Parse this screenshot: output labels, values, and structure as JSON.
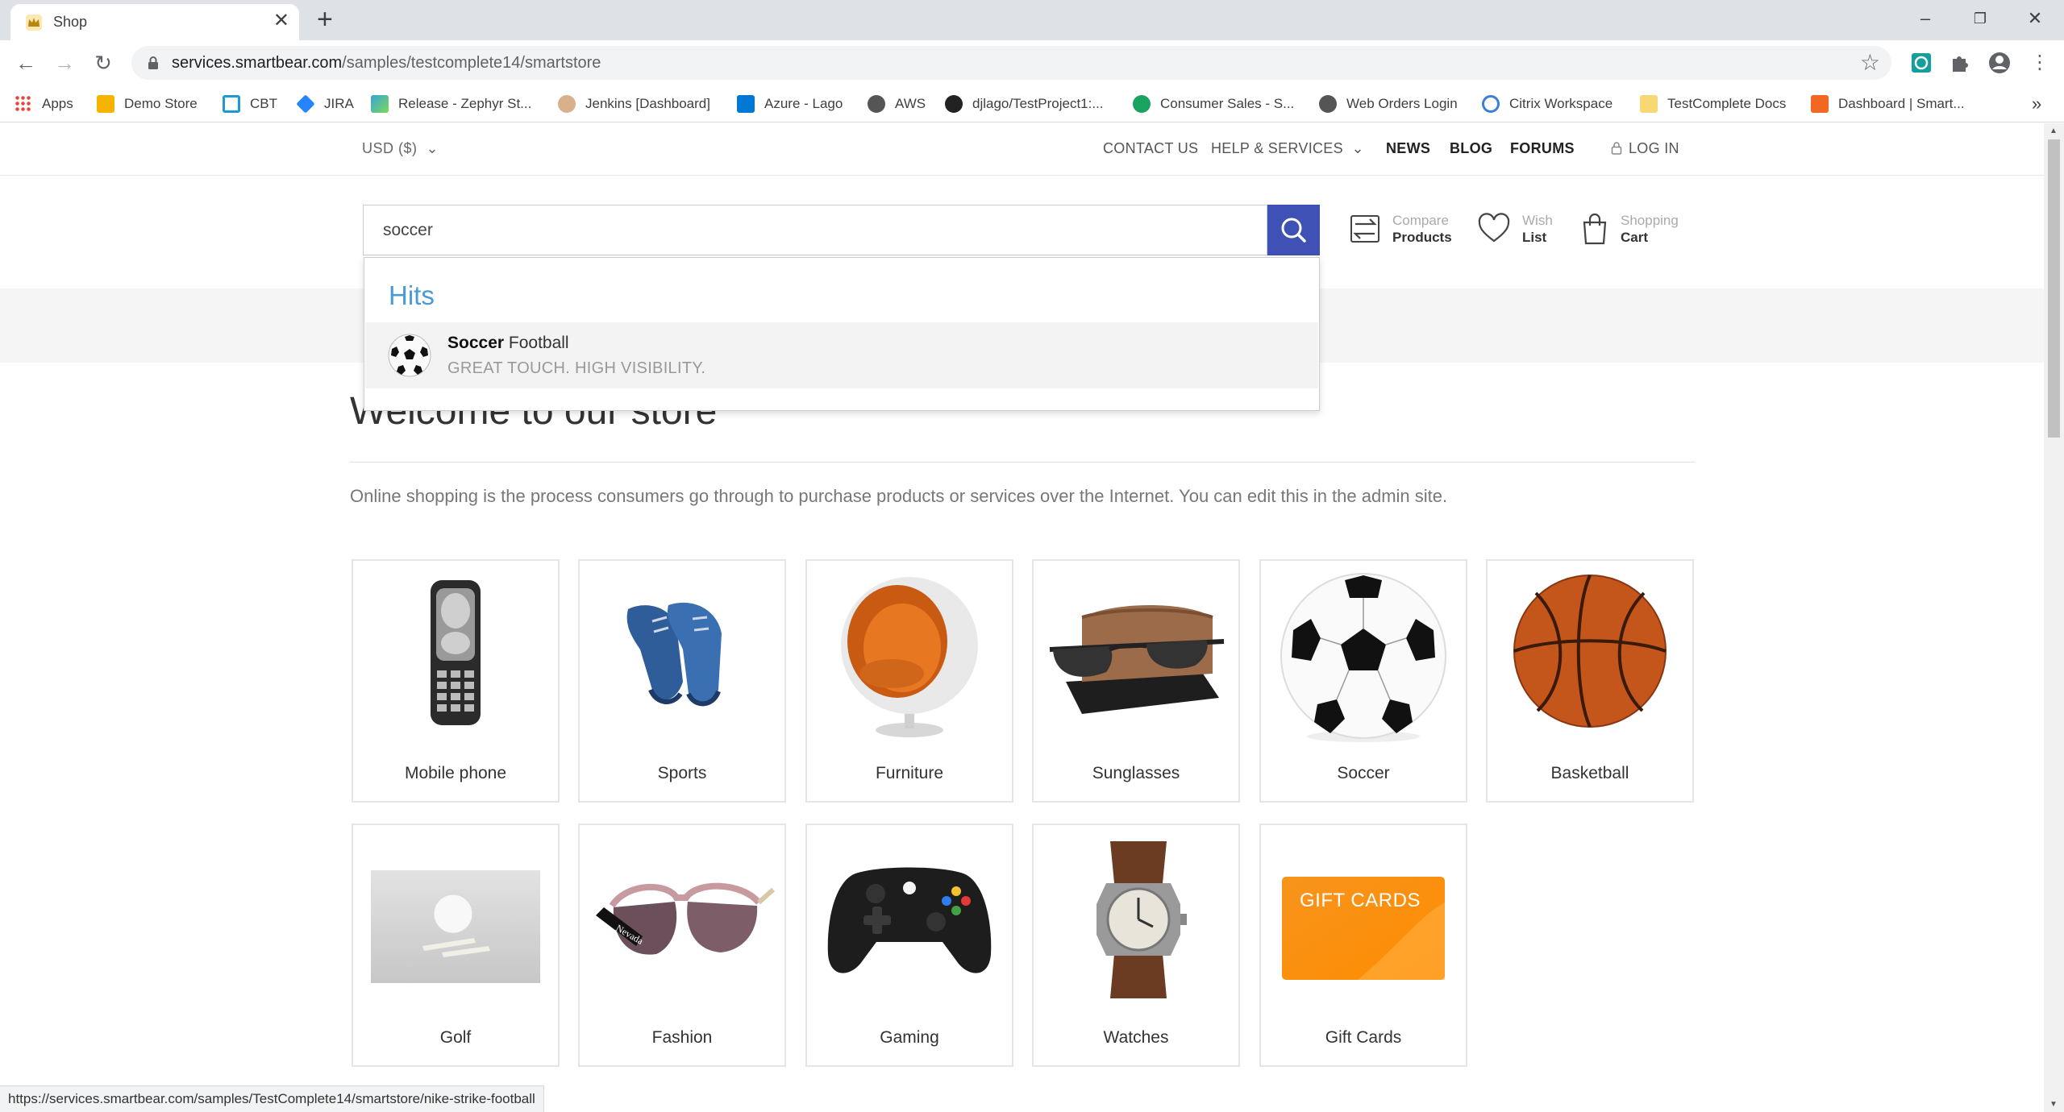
{
  "browser": {
    "tab_title": "Shop",
    "url_host": "services.smartbear.com",
    "url_path": "/samples/testcomplete14/smartstore",
    "window_controls": [
      "minimize-icon",
      "restore-icon",
      "close-icon"
    ]
  },
  "bookmarks": [
    {
      "label": "Apps",
      "icon": "apps-grid-icon",
      "color": "#e8453c"
    },
    {
      "label": "Demo Store",
      "icon": "crown-icon",
      "color": "#f5b400"
    },
    {
      "label": "CBT",
      "icon": "cbt-icon",
      "color": "#1b9ad6"
    },
    {
      "label": "JIRA",
      "icon": "jira-icon",
      "color": "#2684ff"
    },
    {
      "label": "Release - Zephyr St...",
      "icon": "zephyr-icon",
      "color": "#36a3d9"
    },
    {
      "label": "Jenkins [Dashboard]",
      "icon": "jenkins-icon",
      "color": "#b58a6a"
    },
    {
      "label": "Azure - Lago",
      "icon": "azure-icon",
      "color": "#0078d4"
    },
    {
      "label": "AWS",
      "icon": "globe-icon",
      "color": "#555555"
    },
    {
      "label": "djlago/TestProject1:...",
      "icon": "github-icon",
      "color": "#222222"
    },
    {
      "label": "Consumer Sales - S...",
      "icon": "sheet-icon",
      "color": "#1aa260"
    },
    {
      "label": "Web Orders Login",
      "icon": "globe-icon",
      "color": "#555555"
    },
    {
      "label": "Citrix Workspace",
      "icon": "citrix-icon",
      "color": "#3b7fd6"
    },
    {
      "label": "TestComplete Docs",
      "icon": "folder-icon",
      "color": "#f8d775"
    },
    {
      "label": "Dashboard | Smart...",
      "icon": "smartbear-icon",
      "color": "#f26722"
    }
  ],
  "topnav": {
    "currency": "USD  ($)",
    "contact": "CONTACT US",
    "help": "HELP & SERVICES",
    "news": "NEWS",
    "blog": "BLOG",
    "forums": "FORUMS",
    "login": "LOG IN"
  },
  "search": {
    "value": "soccer",
    "accent_color": "#3f51b5"
  },
  "header_actions": [
    {
      "small": "Compare",
      "big": "Products",
      "icon": "compare-icon"
    },
    {
      "small": "Wish",
      "big": "List",
      "icon": "heart-icon"
    },
    {
      "small": "Shopping",
      "big": "Cart",
      "icon": "shopping-bag-icon"
    }
  ],
  "suggest": {
    "heading": "Hits",
    "item_bold": "Soccer",
    "item_rest": " Football",
    "item_sub": "GREAT TOUCH. HIGH VISIBILITY."
  },
  "welcome": {
    "title": "Welcome to our store",
    "text": "Online shopping is the process consumers go through to purchase products or services over the Internet. You can edit this in the admin site."
  },
  "categories": [
    {
      "name": "Mobile phone",
      "icon": "mobile-phone-icon"
    },
    {
      "name": "Sports",
      "icon": "sneakers-icon"
    },
    {
      "name": "Furniture",
      "icon": "ball-chair-icon"
    },
    {
      "name": "Sunglasses",
      "icon": "sunglasses-icon"
    },
    {
      "name": "Soccer",
      "icon": "soccer-ball-icon"
    },
    {
      "name": "Basketball",
      "icon": "basketball-icon"
    },
    {
      "name": "Golf",
      "icon": "golf-ball-icon"
    },
    {
      "name": "Fashion",
      "icon": "fashion-glasses-icon"
    },
    {
      "name": "Gaming",
      "icon": "gamepad-icon"
    },
    {
      "name": "Watches",
      "icon": "watch-icon"
    },
    {
      "name": "Gift Cards",
      "icon": "gift-card-icon",
      "card_text": "GIFT CARDS"
    }
  ],
  "status_url": "https://services.smartbear.com/samples/TestComplete14/smartstore/nike-strike-football"
}
